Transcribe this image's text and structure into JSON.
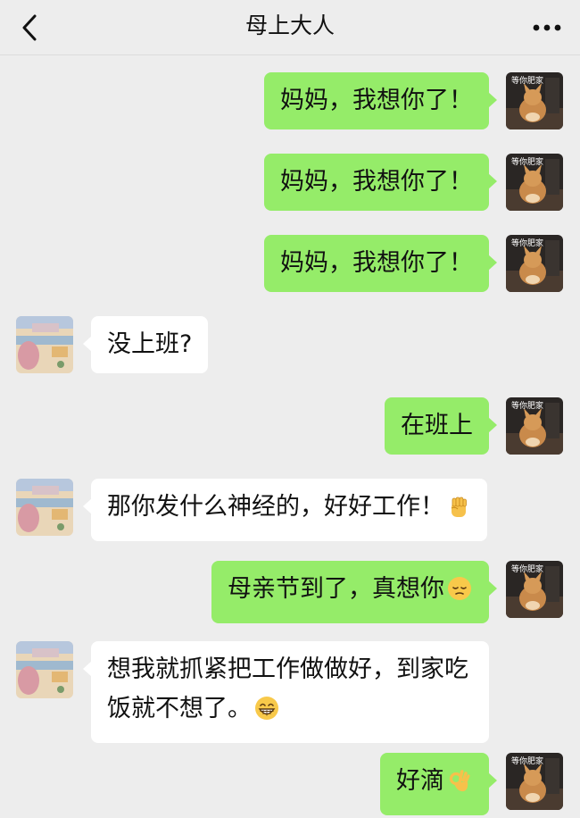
{
  "header": {
    "title": "母上大人",
    "back_icon": "chevron-left-icon",
    "more_icon": "more-dots-icon"
  },
  "my_avatar_label": "等你肥家",
  "messages": [
    {
      "sender": "me",
      "text": "妈妈，我想你了！"
    },
    {
      "sender": "me",
      "text": "妈妈，我想你了！"
    },
    {
      "sender": "me",
      "text": "妈妈，我想你了！"
    },
    {
      "sender": "other",
      "text": "没上班?"
    },
    {
      "sender": "me",
      "text": "在班上"
    },
    {
      "sender": "other",
      "text": "那你发什么神经的，好好工作！",
      "emoji": "raised-fist-emoji"
    },
    {
      "sender": "me",
      "text": "母亲节到了，真想你",
      "emoji": "pensive-face-emoji"
    },
    {
      "sender": "other",
      "text": "想我就抓紧把工作做做好，到家吃饭就不想了。",
      "emoji": "grinning-face-emoji"
    },
    {
      "sender": "me",
      "text": "好滴",
      "emoji": "ok-hand-emoji"
    }
  ],
  "colors": {
    "background": "#ededed",
    "my_bubble": "#95ec69",
    "other_bubble": "#ffffff"
  }
}
